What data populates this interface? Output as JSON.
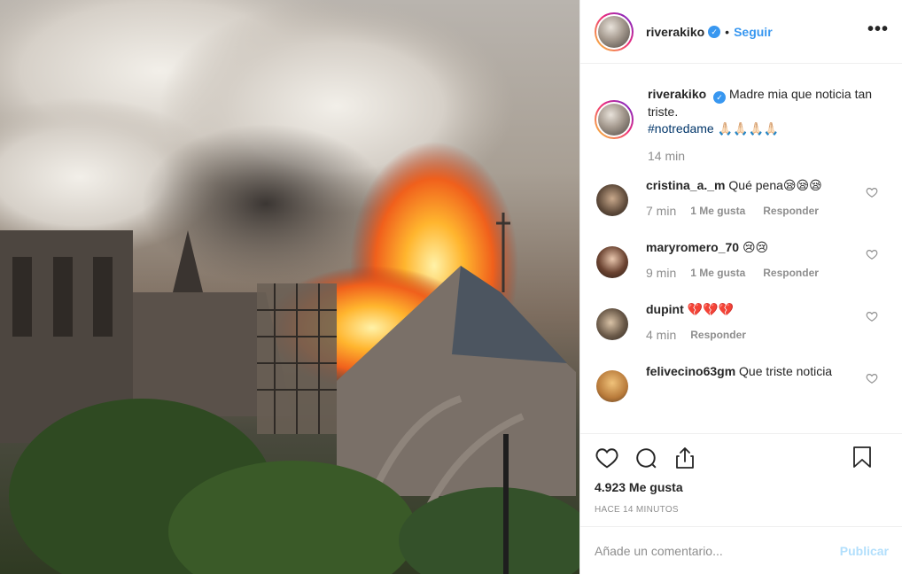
{
  "post": {
    "username": "riverakiko",
    "verified_mark": "✓",
    "separator": "•",
    "follow_label": "Seguir",
    "more_label": "•••"
  },
  "caption": {
    "username": "riverakiko",
    "text": "Madre mia que noticia tan triste.",
    "hashtag": "#notredame",
    "emojis": "🙏🏻🙏🏻🙏🏻🙏🏻",
    "time": "14 min"
  },
  "comments": [
    {
      "username": "cristina_a._m",
      "text": "Qué pena😪😪😪",
      "time": "7 min",
      "likes": "1 Me gusta",
      "reply": "Responder"
    },
    {
      "username": "maryromero_70",
      "text": "😢😢",
      "time": "9 min",
      "likes": "1 Me gusta",
      "reply": "Responder"
    },
    {
      "username": "dupint",
      "text": "💔💔💔",
      "time": "4 min",
      "reply": "Responder"
    },
    {
      "username": "felivecino63gm",
      "text": "Que triste noticia"
    }
  ],
  "stats": {
    "likes": "4.923 Me gusta",
    "ago": "HACE 14 MINUTOS"
  },
  "add_comment": {
    "placeholder": "Añade un comentario...",
    "publish": "Publicar"
  },
  "colors": {
    "accent": "#3897f0",
    "hashtag": "#003569",
    "muted": "#8e8e8e",
    "publish_disabled": "#b2dffc"
  },
  "icons": [
    "heart-icon",
    "comment-icon",
    "share-icon",
    "bookmark-icon",
    "more-options-icon",
    "verified-badge-icon"
  ]
}
